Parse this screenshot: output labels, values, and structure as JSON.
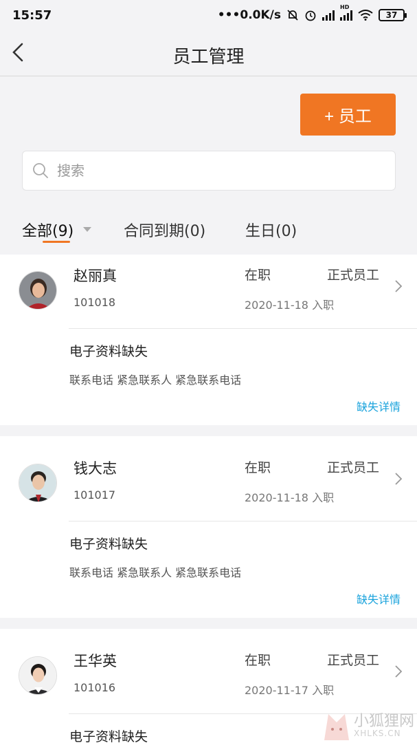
{
  "status_bar": {
    "time": "15:57",
    "network_speed": "•••0.0K/s",
    "hd_label": "HD",
    "battery": "37"
  },
  "header": {
    "title": "员工管理",
    "back_icon": "back-arrow-icon"
  },
  "add_button": {
    "label": "+ 员工"
  },
  "search": {
    "placeholder": "搜索",
    "value": ""
  },
  "tabs": [
    {
      "label": "全部(9)",
      "active": true
    },
    {
      "label": "合同到期(0)",
      "active": false
    },
    {
      "label": "生日(0)",
      "active": false
    }
  ],
  "employees": [
    {
      "name": "赵丽真",
      "id": "101018",
      "status": "在职",
      "type": "正式员工",
      "join_date": "2020-11-18 入职",
      "missing_title": "电子资料缺失",
      "missing_items": "联系电话 紧急联系人 紧急联系电话",
      "missing_link": "缺失详情"
    },
    {
      "name": "钱大志",
      "id": "101017",
      "status": "在职",
      "type": "正式员工",
      "join_date": "2020-11-18 入职",
      "missing_title": "电子资料缺失",
      "missing_items": "联系电话 紧急联系人 紧急联系电话",
      "missing_link": "缺失详情"
    },
    {
      "name": "王华英",
      "id": "101016",
      "status": "在职",
      "type": "正式员工",
      "join_date": "2020-11-17 入职",
      "missing_title": "电子资料缺失"
    }
  ],
  "watermark": {
    "title": "小狐狸网",
    "url": "XHLKS.CN"
  },
  "colors": {
    "accent": "#f07623",
    "link": "#1aa3dc",
    "background": "#f3f3f5"
  }
}
